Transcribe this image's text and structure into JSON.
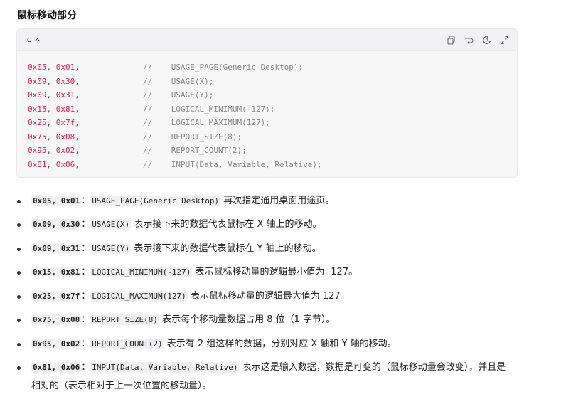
{
  "section_title": "鼠标移动部分",
  "code_block": {
    "language": "c",
    "colors": {
      "hex": "#c7254e",
      "comment": "#8a8a8a"
    },
    "tool_icons": [
      "copy-icon",
      "wrap-icon",
      "theme-icon",
      "expand-icon"
    ],
    "lines": [
      {
        "a": "0x05",
        "b": "0x01",
        "comment": "//    USAGE_PAGE(Generic Desktop);"
      },
      {
        "a": "0x09",
        "b": "0x30",
        "comment": "//    USAGE(X);"
      },
      {
        "a": "0x09",
        "b": "0x31",
        "comment": "//    USAGE(Y);"
      },
      {
        "a": "0x15",
        "b": "0x81",
        "comment": "//    LOGICAL_MINIMUM(-127);"
      },
      {
        "a": "0x25",
        "b": "0x7f",
        "comment": "//    LOGICAL_MAXIMUM(127);"
      },
      {
        "a": "0x75",
        "b": "0x08",
        "comment": "//    REPORT_SIZE(8);"
      },
      {
        "a": "0x95",
        "b": "0x02",
        "comment": "//    REPORT_COUNT(2);"
      },
      {
        "a": "0x81",
        "b": "0x06",
        "comment": "//    INPUT(Data, Variable, Relative);"
      }
    ]
  },
  "bullets": [
    {
      "bytes": "0x05, 0x01",
      "sep": "：",
      "code": "USAGE_PAGE(Generic Desktop)",
      "desc": " 再次指定通用桌面用途页。"
    },
    {
      "bytes": "0x09, 0x30",
      "sep": "：",
      "code": "USAGE(X)",
      "desc": " 表示接下来的数据代表鼠标在 X 轴上的移动。"
    },
    {
      "bytes": "0x09, 0x31",
      "sep": "：",
      "code": "USAGE(Y)",
      "desc": " 表示接下来的数据代表鼠标在 Y 轴上的移动。"
    },
    {
      "bytes": "0x15, 0x81",
      "sep": "：",
      "code": "LOGICAL_MINIMUM(-127)",
      "desc": " 表示鼠标移动量的逻辑最小值为 -127。"
    },
    {
      "bytes": "0x25, 0x7f",
      "sep": "：",
      "code": "LOGICAL_MAXIMUM(127)",
      "desc": " 表示鼠标移动量的逻辑最大值为 127。"
    },
    {
      "bytes": "0x75, 0x08",
      "sep": "：",
      "code": "REPORT_SIZE(8)",
      "desc": " 表示每个移动量数据占用 8 位（1 字节）。"
    },
    {
      "bytes": "0x95, 0x02",
      "sep": "：",
      "code": "REPORT_COUNT(2)",
      "desc": " 表示有 2 组这样的数据，分别对应 X 轴和 Y 轴的移动。"
    },
    {
      "bytes": "0x81, 0x06",
      "sep": "：",
      "code": "INPUT(Data, Variable, Relative)",
      "desc": " 表示这是输入数据，数据是可变的（鼠标移动量会改变），并且是相对的（表示相对于上一次位置的移动量）。"
    }
  ]
}
